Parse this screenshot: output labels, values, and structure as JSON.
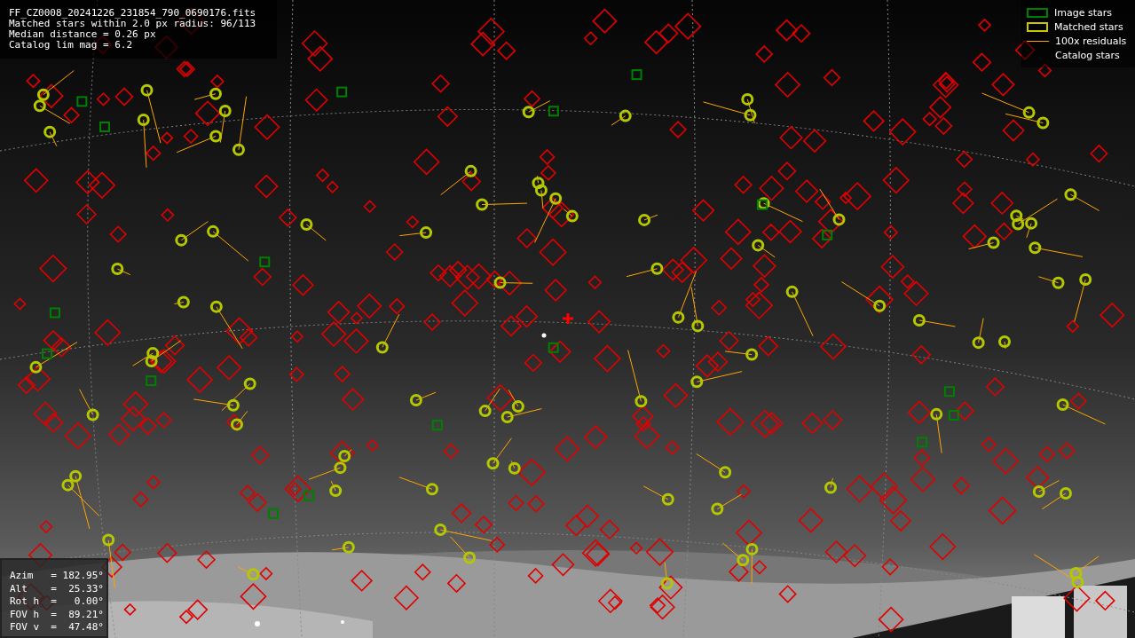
{
  "file_info": [
    "FF_CZ0008_20241226_231854_790_0690176.fits",
    "Matched stars within 2.0 px radius: 96/113",
    "Median distance = 0.26 px",
    "Catalog lim mag = 6.2"
  ],
  "legend": [
    {
      "kind": "box",
      "label": "Image stars",
      "color": "#008000"
    },
    {
      "kind": "box",
      "label": "Matched stars",
      "color": "#c8c800"
    },
    {
      "kind": "line",
      "label": "100x residuals",
      "color": "#ffa500"
    },
    {
      "kind": "none",
      "label": "Catalog stars"
    }
  ],
  "pointing": [
    "Azim   = 182.95°",
    "Alt    =  25.33°",
    "Rot h  =   0.00°",
    "FOV h  =  89.21°",
    "FOV v  =  47.48°"
  ]
}
